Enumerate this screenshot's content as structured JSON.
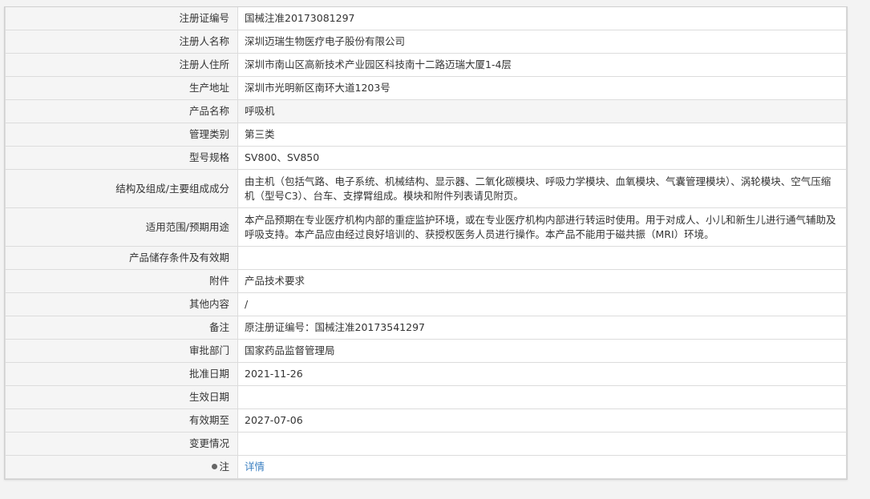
{
  "rows": [
    {
      "label": "注册证编号",
      "value": "国械注准20173081297"
    },
    {
      "label": "注册人名称",
      "value": "深圳迈瑞生物医疗电子股份有限公司"
    },
    {
      "label": "注册人住所",
      "value": "深圳市南山区高新技术产业园区科技南十二路迈瑞大厦1-4层"
    },
    {
      "label": "生产地址",
      "value": "深圳市光明新区南环大道1203号"
    },
    {
      "label": "产品名称",
      "value": "呼吸机"
    },
    {
      "label": "管理类别",
      "value": "第三类"
    },
    {
      "label": "型号规格",
      "value": "SV800、SV850"
    },
    {
      "label": "结构及组成/主要组成成分",
      "value": "由主机（包括气路、电子系统、机械结构、显示器、二氧化碳模块、呼吸力学模块、血氧模块、气囊管理模块）、涡轮模块、空气压缩机（型号C3）、台车、支撑臂组成。模块和附件列表请见附页。"
    },
    {
      "label": "适用范围/预期用途",
      "value": "本产品预期在专业医疗机构内部的重症监护环境，或在专业医疗机构内部进行转运时使用。用于对成人、小儿和新生儿进行通气辅助及呼吸支持。本产品应由经过良好培训的、获授权医务人员进行操作。本产品不能用于磁共振（MRI）环境。"
    },
    {
      "label": "产品储存条件及有效期",
      "value": ""
    },
    {
      "label": "附件",
      "value": "产品技术要求"
    },
    {
      "label": "其他内容",
      "value": "/"
    },
    {
      "label": "备注",
      "value": "原注册证编号：国械注准20173541297"
    },
    {
      "label": "审批部门",
      "value": "国家药品监督管理局"
    },
    {
      "label": "批准日期",
      "value": "2021-11-26"
    },
    {
      "label": "生效日期",
      "value": ""
    },
    {
      "label": "有效期至",
      "value": "2027-07-06"
    },
    {
      "label": "变更情况",
      "value": ""
    }
  ],
  "note": {
    "label": "注",
    "link_text": "详情",
    "icon": "pin-icon"
  },
  "colors": {
    "link": "#3a7fc1",
    "label_bg": "#f5f5f5",
    "border": "#dcdcdc"
  }
}
